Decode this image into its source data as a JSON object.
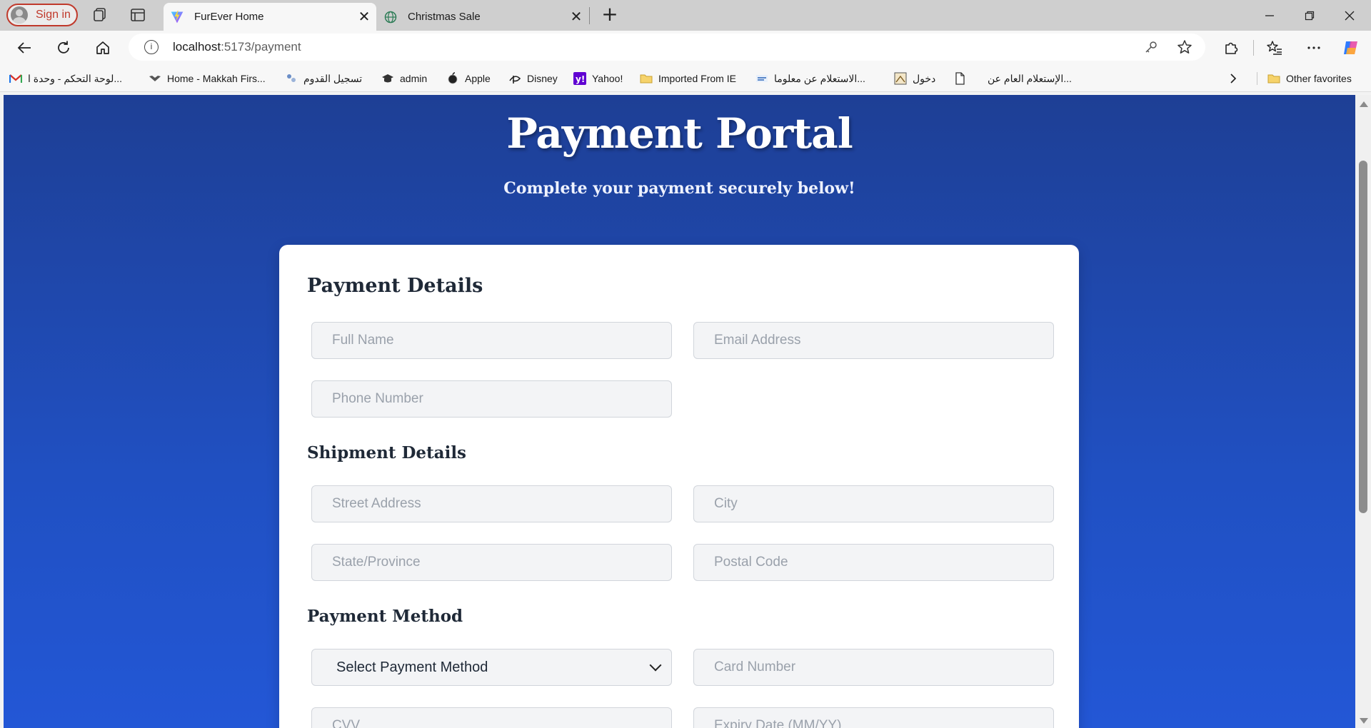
{
  "browser": {
    "signin_label": "Sign in",
    "tabs": [
      {
        "title": "FurEver Home",
        "active": true,
        "favicon": "vite-logo-icon"
      },
      {
        "title": "Christmas Sale",
        "active": false,
        "favicon": "globe-icon"
      }
    ],
    "address": {
      "host": "localhost",
      "path": ":5173/payment"
    },
    "bookmarks": [
      {
        "label": "لوحة التحكم - وحدة ا...",
        "icon": "gmail-icon"
      },
      {
        "label": "Home - Makkah Firs...",
        "icon": "site-icon"
      },
      {
        "label": "تسجيل القدوم",
        "icon": "site-icon"
      },
      {
        "label": "admin",
        "icon": "graduation-cap-icon"
      },
      {
        "label": "Apple",
        "icon": "apple-icon"
      },
      {
        "label": "Disney",
        "icon": "disney-icon"
      },
      {
        "label": "Yahoo!",
        "icon": "yahoo-icon"
      },
      {
        "label": "Imported From IE",
        "icon": "folder-icon"
      },
      {
        "label": "الاستعلام عن معلوما...",
        "icon": "site-icon"
      },
      {
        "label": "دخول",
        "icon": "site-icon"
      },
      {
        "label": "الإستعلام العام عن...",
        "icon": "page-icon"
      }
    ],
    "other_favorites": "Other favorites"
  },
  "page": {
    "title": "Payment Portal",
    "subtitle": "Complete your payment securely below!",
    "sections": {
      "payment_details": "Payment Details",
      "shipment_details": "Shipment Details",
      "payment_method": "Payment Method"
    },
    "fields": {
      "full_name": "Full Name",
      "email": "Email Address",
      "phone": "Phone Number",
      "street": "Street Address",
      "city": "City",
      "state": "State/Province",
      "postal": "Postal Code",
      "card_number": "Card Number",
      "cvv": "CVV",
      "expiry": "Expiry Date (MM/YY)"
    },
    "payment_select": {
      "selected": "Select Payment Method"
    }
  },
  "colors": {
    "page_gradient_top": "#1e3f95",
    "page_gradient_bottom": "#2357d6",
    "card": "#ffffff",
    "input_bg": "#f3f4f6",
    "signin_accent": "#c0392b"
  }
}
